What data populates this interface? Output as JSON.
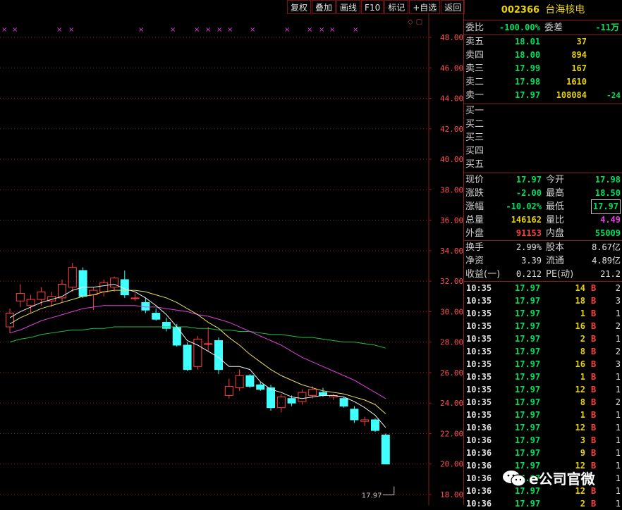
{
  "toolbar": {
    "buttons": [
      "复权",
      "叠加",
      "画线",
      "F10",
      "标记",
      "+自选",
      "返回"
    ]
  },
  "stock": {
    "code": "002366",
    "name": "台海核电"
  },
  "order_ratio": {
    "label1": "委比",
    "value1": "-100.00%",
    "label2": "委差",
    "value2": "-11万"
  },
  "asks": [
    {
      "label": "卖五",
      "price": "18.01",
      "volume": "37",
      "change": ""
    },
    {
      "label": "卖四",
      "price": "18.00",
      "volume": "894",
      "change": ""
    },
    {
      "label": "卖三",
      "price": "17.99",
      "volume": "167",
      "change": ""
    },
    {
      "label": "卖二",
      "price": "17.98",
      "volume": "1610",
      "change": ""
    },
    {
      "label": "卖一",
      "price": "17.97",
      "volume": "108084",
      "change": "-24"
    }
  ],
  "bids": [
    {
      "label": "买一"
    },
    {
      "label": "买二"
    },
    {
      "label": "买三"
    },
    {
      "label": "买四"
    },
    {
      "label": "买五"
    }
  ],
  "quote": [
    {
      "l1": "现价",
      "v1": "17.97",
      "c1": "g",
      "l2": "今开",
      "v2": "17.98",
      "c2": "g"
    },
    {
      "l1": "涨跌",
      "v1": "-2.00",
      "c1": "g",
      "l2": "最高",
      "v2": "18.50",
      "c2": "g"
    },
    {
      "l1": "涨幅",
      "v1": "-10.02%",
      "c1": "g",
      "l2": "最低",
      "v2": "17.97",
      "c2": "g"
    },
    {
      "l1": "总量",
      "v1": "146162",
      "c1": "y",
      "l2": "量比",
      "v2": "4.49",
      "c2": "m"
    },
    {
      "l1": "外盘",
      "v1": "91153",
      "c1": "r",
      "l2": "内盘",
      "v2": "55009",
      "c2": "g"
    }
  ],
  "fundamentals": [
    {
      "l1": "换手",
      "v1": "2.99%",
      "l2": "股本",
      "v2": "8.67亿"
    },
    {
      "l1": "净资",
      "v1": "3.39",
      "l2": "流通",
      "v2": "4.89亿"
    },
    {
      "l1": "收益(一)",
      "v1": "0.212",
      "l2": "PE(动)",
      "v2": "21.2"
    }
  ],
  "ticks": [
    {
      "time": "10:35",
      "price": "17.97",
      "vol": "14",
      "side": "B",
      "n": "2"
    },
    {
      "time": "10:35",
      "price": "17.97",
      "vol": "18",
      "side": "B",
      "n": "3"
    },
    {
      "time": "10:35",
      "price": "17.97",
      "vol": "1",
      "side": "B",
      "n": "1"
    },
    {
      "time": "10:35",
      "price": "17.97",
      "vol": "16",
      "side": "B",
      "n": "2"
    },
    {
      "time": "10:35",
      "price": "17.97",
      "vol": "2",
      "side": "B",
      "n": "1"
    },
    {
      "time": "10:35",
      "price": "17.97",
      "vol": "8",
      "side": "B",
      "n": "2"
    },
    {
      "time": "10:35",
      "price": "17.97",
      "vol": "16",
      "side": "B",
      "n": "3"
    },
    {
      "time": "10:35",
      "price": "17.97",
      "vol": "1",
      "side": "B",
      "n": "1"
    },
    {
      "time": "10:35",
      "price": "17.97",
      "vol": "12",
      "side": "B",
      "n": "1"
    },
    {
      "time": "10:35",
      "price": "17.97",
      "vol": "8",
      "side": "B",
      "n": "2"
    },
    {
      "time": "10:35",
      "price": "17.97",
      "vol": "1",
      "side": "B",
      "n": "1"
    },
    {
      "time": "10:36",
      "price": "17.97",
      "vol": "12",
      "side": "B",
      "n": "1"
    },
    {
      "time": "10:36",
      "price": "17.97",
      "vol": "3",
      "side": "B",
      "n": "1"
    },
    {
      "time": "10:36",
      "price": "17.97",
      "vol": "9",
      "side": "B",
      "n": "1"
    },
    {
      "time": "10:36",
      "price": "17.97",
      "vol": "12",
      "side": "B",
      "n": "1"
    },
    {
      "time": "10:36",
      "price": "17.97",
      "vol": "",
      "side": "",
      "n": "1"
    },
    {
      "time": "10:36",
      "price": "17.97",
      "vol": "12",
      "side": "B",
      "n": "1"
    },
    {
      "time": "10:36",
      "price": "17.97",
      "vol": "2",
      "side": "B",
      "n": "1"
    }
  ],
  "watermark": {
    "text": "e公司官微"
  },
  "colors": {
    "up": "#ff4040",
    "down": "#40ffff",
    "ma5": "#f0f0f0",
    "ma10": "#e8e060",
    "ma20": "#e040e0",
    "ma60": "#20c040",
    "grid": "#8b1a1a",
    "axis_text": "#ff5050"
  },
  "chart_data": {
    "type": "candlestick",
    "ylim": [
      18,
      49
    ],
    "yticks": [
      "48.00",
      "46.00",
      "44.00",
      "42.00",
      "40.00",
      "38.00",
      "36.00",
      "34.00",
      "32.00",
      "30.00",
      "28.00",
      "26.00",
      "24.00",
      "22.00",
      "20.00",
      "18.00"
    ],
    "last_price_label": "17.97",
    "marker_count": 16,
    "candles": [
      {
        "o": 29.0,
        "h": 30.2,
        "l": 28.6,
        "c": 29.9
      },
      {
        "o": 30.7,
        "h": 31.8,
        "l": 30.3,
        "c": 31.2
      },
      {
        "o": 30.4,
        "h": 31.1,
        "l": 29.9,
        "c": 30.8
      },
      {
        "o": 30.8,
        "h": 31.6,
        "l": 30.4,
        "c": 31.3
      },
      {
        "o": 30.7,
        "h": 31.3,
        "l": 30.3,
        "c": 31.0
      },
      {
        "o": 30.9,
        "h": 32.1,
        "l": 30.6,
        "c": 31.8
      },
      {
        "o": 31.6,
        "h": 33.2,
        "l": 31.3,
        "c": 32.9
      },
      {
        "o": 32.7,
        "h": 32.9,
        "l": 30.9,
        "c": 31.0
      },
      {
        "o": 31.1,
        "h": 31.6,
        "l": 30.1,
        "c": 31.4
      },
      {
        "o": 31.3,
        "h": 32.1,
        "l": 31.0,
        "c": 31.9
      },
      {
        "o": 31.6,
        "h": 32.3,
        "l": 31.3,
        "c": 32.2
      },
      {
        "o": 32.1,
        "h": 32.7,
        "l": 30.9,
        "c": 31.1
      },
      {
        "o": 30.9,
        "h": 31.2,
        "l": 30.7,
        "c": 30.9
      },
      {
        "o": 30.6,
        "h": 30.9,
        "l": 29.9,
        "c": 30.1
      },
      {
        "o": 29.9,
        "h": 30.2,
        "l": 29.4,
        "c": 29.5
      },
      {
        "o": 29.3,
        "h": 29.6,
        "l": 28.7,
        "c": 28.9
      },
      {
        "o": 29.0,
        "h": 29.2,
        "l": 27.7,
        "c": 27.8
      },
      {
        "o": 27.8,
        "h": 28.0,
        "l": 26.1,
        "c": 26.2
      },
      {
        "o": 26.4,
        "h": 28.4,
        "l": 26.2,
        "c": 28.2
      },
      {
        "o": 27.9,
        "h": 29.0,
        "l": 27.4,
        "c": 27.9
      },
      {
        "o": 28.1,
        "h": 28.3,
        "l": 25.9,
        "c": 26.2
      },
      {
        "o": 24.5,
        "h": 25.6,
        "l": 24.3,
        "c": 25.1
      },
      {
        "o": 25.0,
        "h": 26.2,
        "l": 24.8,
        "c": 25.8
      },
      {
        "o": 25.8,
        "h": 25.9,
        "l": 25.0,
        "c": 25.1
      },
      {
        "o": 25.2,
        "h": 25.4,
        "l": 24.8,
        "c": 24.9
      },
      {
        "o": 25.0,
        "h": 25.2,
        "l": 23.5,
        "c": 23.7
      },
      {
        "o": 23.7,
        "h": 24.6,
        "l": 23.4,
        "c": 24.4
      },
      {
        "o": 24.3,
        "h": 24.5,
        "l": 23.8,
        "c": 24.0
      },
      {
        "o": 24.1,
        "h": 24.9,
        "l": 23.9,
        "c": 24.7
      },
      {
        "o": 24.5,
        "h": 25.1,
        "l": 24.3,
        "c": 24.9
      },
      {
        "o": 24.7,
        "h": 25.0,
        "l": 24.4,
        "c": 24.5
      },
      {
        "o": 24.4,
        "h": 24.6,
        "l": 24.2,
        "c": 24.5
      },
      {
        "o": 24.3,
        "h": 24.4,
        "l": 23.7,
        "c": 23.8
      },
      {
        "o": 23.6,
        "h": 23.8,
        "l": 22.7,
        "c": 22.9
      },
      {
        "o": 22.8,
        "h": 23.1,
        "l": 22.5,
        "c": 22.9
      },
      {
        "o": 22.9,
        "h": 23.0,
        "l": 22.1,
        "c": 22.2
      },
      {
        "o": 21.9,
        "h": 22.0,
        "l": 20.0,
        "c": 20.0
      }
    ],
    "ma5": [
      29.6,
      30.0,
      30.3,
      30.6,
      30.8,
      31.0,
      31.4,
      31.6,
      31.6,
      31.7,
      31.8,
      31.5,
      31.3,
      30.9,
      30.4,
      29.8,
      29.0,
      28.1,
      27.8,
      27.4,
      27.0,
      26.4,
      26.4,
      26.2,
      25.4,
      24.9,
      24.7,
      24.4,
      24.3,
      24.4,
      24.5,
      24.5,
      24.4,
      24.1,
      23.7,
      23.2,
      22.4
    ],
    "ma10": [
      29.2,
      29.6,
      29.9,
      30.2,
      30.4,
      30.6,
      30.8,
      31.0,
      31.1,
      31.3,
      31.4,
      31.4,
      31.4,
      31.3,
      31.1,
      30.9,
      30.6,
      30.2,
      29.8,
      29.3,
      28.9,
      28.3,
      27.8,
      27.2,
      26.7,
      26.2,
      25.8,
      25.5,
      25.2,
      25.0,
      24.8,
      24.7,
      24.6,
      24.4,
      24.2,
      23.9,
      23.3
    ],
    "ma20": [
      28.6,
      28.8,
      29.1,
      29.4,
      29.6,
      29.8,
      30.0,
      30.2,
      30.3,
      30.4,
      30.4,
      30.4,
      30.4,
      30.3,
      30.3,
      30.2,
      30.1,
      30.0,
      29.8,
      29.7,
      29.5,
      29.3,
      29.0,
      28.7,
      28.4,
      28.1,
      27.8,
      27.4,
      27.0,
      26.7,
      26.4,
      26.1,
      25.8,
      25.5,
      25.1,
      24.7,
      24.3
    ],
    "ma60": [
      28.0,
      28.2,
      28.3,
      28.5,
      28.6,
      28.7,
      28.8,
      28.8,
      28.9,
      28.9,
      29.0,
      29.0,
      29.0,
      29.0,
      29.0,
      29.0,
      29.0,
      29.0,
      28.9,
      28.9,
      28.8,
      28.8,
      28.7,
      28.7,
      28.6,
      28.5,
      28.5,
      28.4,
      28.3,
      28.3,
      28.2,
      28.1,
      28.0,
      28.0,
      27.9,
      27.8,
      27.6
    ]
  }
}
